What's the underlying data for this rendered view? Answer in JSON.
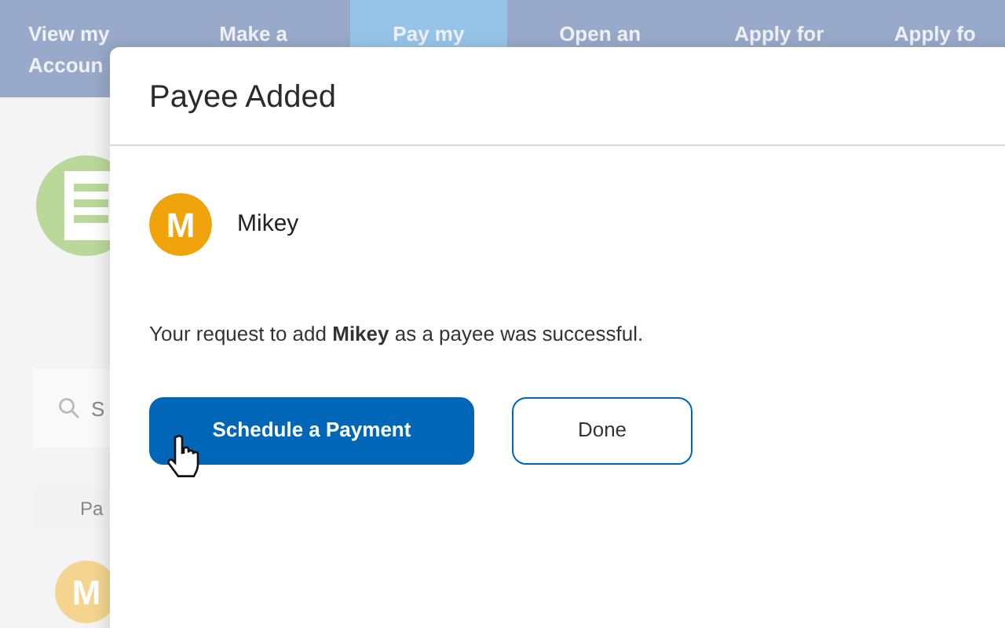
{
  "nav": {
    "tabs": [
      {
        "lines": [
          "View my",
          "Accoun"
        ],
        "selected": false
      },
      {
        "lines": [
          "Make a"
        ],
        "selected": false
      },
      {
        "lines": [
          "Pay my"
        ],
        "selected": true
      },
      {
        "lines": [
          "Open an"
        ],
        "selected": false
      },
      {
        "lines": [
          "Apply for"
        ],
        "selected": false
      },
      {
        "lines": [
          "Apply fo"
        ],
        "selected": false
      }
    ]
  },
  "background": {
    "search_placeholder": "S",
    "table_header": "Pa",
    "avatar_initial": "M"
  },
  "modal": {
    "title": "Payee Added",
    "payee": {
      "initial": "M",
      "name": "Mikey"
    },
    "message": "Your request to add **Mikey** as a payee was successful.",
    "buttons": [
      {
        "label": "Schedule a Payment",
        "kind": "primary"
      },
      {
        "label": "Done",
        "kind": "secondary"
      }
    ]
  }
}
